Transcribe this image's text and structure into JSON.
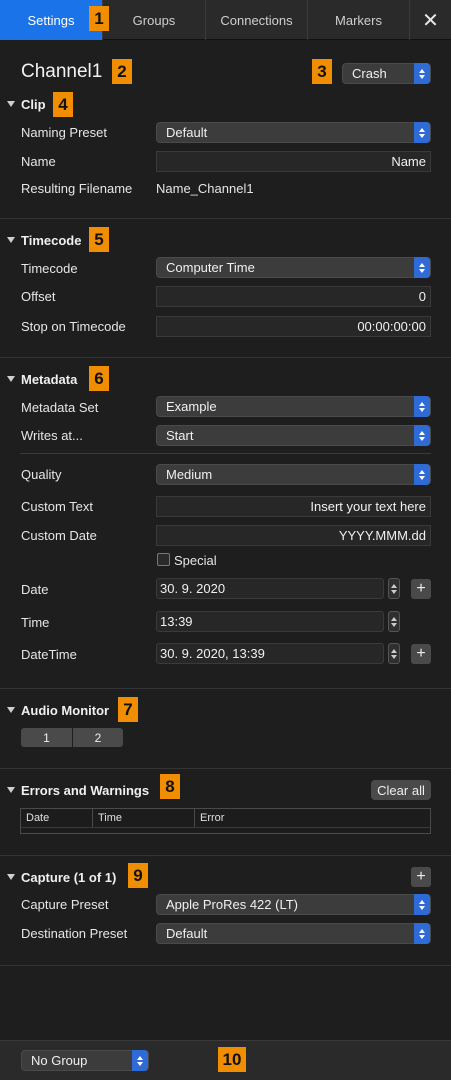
{
  "tabs": [
    {
      "label": "Settings",
      "badge": "1"
    },
    {
      "label": "Groups"
    },
    {
      "label": "Connections"
    },
    {
      "label": "Markers"
    }
  ],
  "close_icon": "close-icon",
  "channel": {
    "name": "Channel1",
    "badge": "2",
    "mode_badge": "3",
    "mode": "Crash"
  },
  "clip": {
    "title": "Clip",
    "badge": "4",
    "naming_preset_label": "Naming Preset",
    "naming_preset": "Default",
    "name_label": "Name",
    "name_value": "Name",
    "resulting_label": "Resulting Filename",
    "resulting_value": "Name_Channel1"
  },
  "timecode": {
    "title": "Timecode",
    "badge": "5",
    "timecode_label": "Timecode",
    "timecode_value": "Computer Time",
    "offset_label": "Offset",
    "offset_value": "0",
    "stop_label": "Stop on Timecode",
    "stop_value": "00:00:00:00"
  },
  "metadata": {
    "title": "Metadata",
    "badge": "6",
    "set_label": "Metadata Set",
    "set_value": "Example",
    "writes_label": "Writes at...",
    "writes_value": "Start",
    "quality_label": "Quality",
    "quality_value": "Medium",
    "custom_text_label": "Custom Text",
    "custom_text_placeholder": "Insert your text here",
    "custom_date_label": "Custom Date",
    "custom_date_placeholder": "YYYY.MMM.dd",
    "special_label": "Special",
    "date_label": "Date",
    "date_value": "30.  9. 2020",
    "time_label": "Time",
    "time_value": "13:39",
    "datetime_label": "DateTime",
    "datetime_value": "30.  9. 2020,  13:39"
  },
  "audio": {
    "title": "Audio Monitor",
    "badge": "7",
    "channels": [
      "1",
      "2"
    ]
  },
  "errors": {
    "title": "Errors and Warnings",
    "badge": "8",
    "clear_label": "Clear all",
    "columns": [
      "Date",
      "Time",
      "Error"
    ]
  },
  "capture": {
    "title": "Capture (1 of 1)",
    "badge": "9",
    "preset_label": "Capture Preset",
    "preset_value": "Apple ProRes 422 (LT)",
    "destination_label": "Destination Preset",
    "destination_value": "Default"
  },
  "bottom": {
    "group_value": "No Group",
    "badge": "10"
  },
  "colors": {
    "accent": "#1a73e8",
    "badge": "#f08d00"
  }
}
